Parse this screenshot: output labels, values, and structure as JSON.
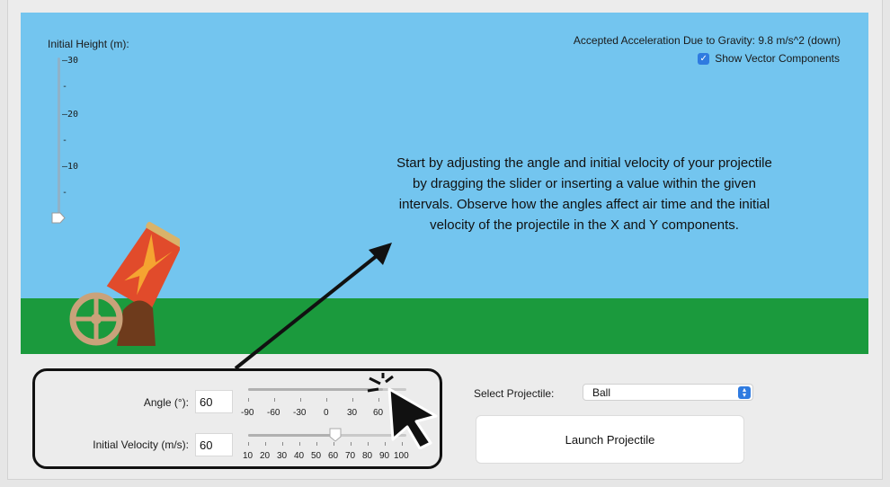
{
  "scene": {
    "height_label": "Initial Height (m):",
    "height_ticks": [
      "30",
      "20",
      "10"
    ],
    "gravity_label": "Accepted Acceleration Due to Gravity: 9.8 m/s^2 (down)",
    "show_vector_label": "Show Vector Components",
    "show_vector_checked": true,
    "instructions": "Start by adjusting the angle and initial velocity of your projectile by dragging the slider or inserting a value within the given intervals. Observe how the angles affect air time and the initial velocity of the projectile in the X and Y components.",
    "initial_height_value": 0
  },
  "controls": {
    "angle_label": "Angle (°):",
    "angle_value": "60",
    "angle_ticks": [
      "-90",
      "-60",
      "-30",
      "0",
      "30",
      "60",
      "90"
    ],
    "velocity_label": "Initial Velocity (m/s):",
    "velocity_value": "60",
    "velocity_ticks": [
      "10",
      "20",
      "30",
      "40",
      "50",
      "60",
      "70",
      "80",
      "90",
      "100"
    ],
    "select_label": "Select Projectile:",
    "projectile": "Ball",
    "launch_label": "Launch Projectile"
  },
  "colors": {
    "sky": "#73c5ef",
    "ground": "#1b9a3d",
    "accent": "#2f7be0"
  }
}
